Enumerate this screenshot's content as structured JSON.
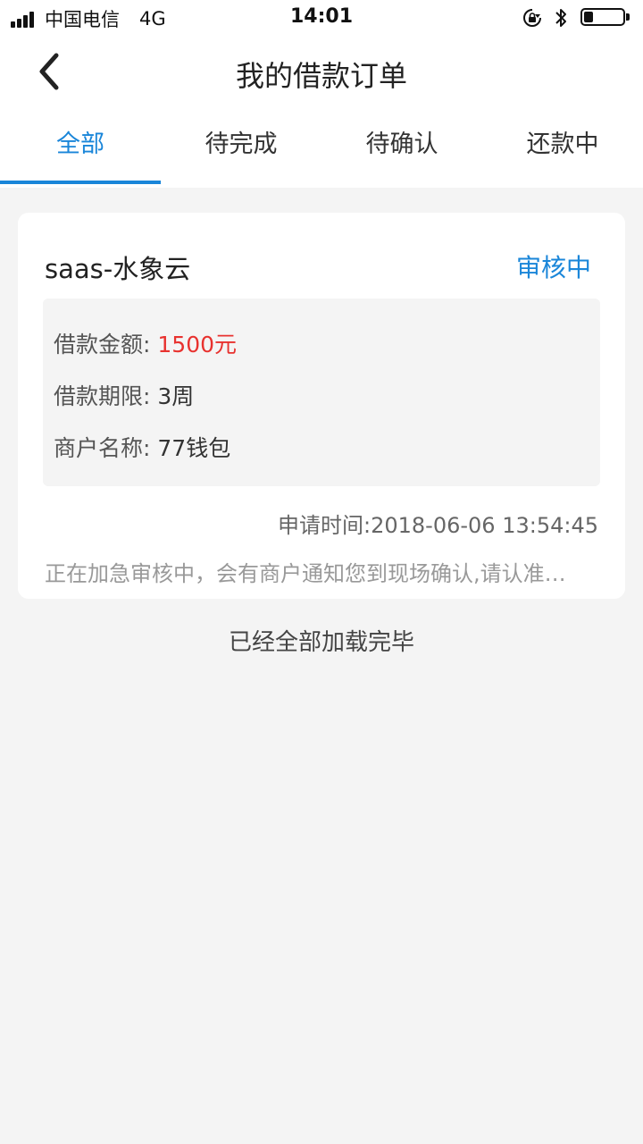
{
  "status_bar": {
    "carrier": "中国电信",
    "network": "4G",
    "time": "14:01",
    "icons": [
      "signal-icon",
      "rotation-lock-icon",
      "bluetooth-icon",
      "battery-icon"
    ],
    "battery_level_fraction": 0.2
  },
  "nav": {
    "title": "我的借款订单",
    "back_icon": "chevron-left-icon"
  },
  "tabs": [
    {
      "label": "全部",
      "active": true
    },
    {
      "label": "待完成",
      "active": false
    },
    {
      "label": "待确认",
      "active": false
    },
    {
      "label": "还款中",
      "active": false
    }
  ],
  "order": {
    "name": "saas-水象云",
    "status": "审核中",
    "amount_label": "借款金额:",
    "amount_value": "1500元",
    "term_label": "借款期限:",
    "term_value": "3周",
    "merchant_label": "商户名称:",
    "merchant_value": "77钱包",
    "apply_time": "申请时间:2018-06-06 13:54:45",
    "note": "正在加急审核中，会有商户通知您到现场确认,请认准…"
  },
  "footer": {
    "loaded_text": "已经全部加载完毕"
  },
  "colors": {
    "accent": "#1a86d9",
    "amount": "#e8322f",
    "background": "#f4f4f4"
  }
}
